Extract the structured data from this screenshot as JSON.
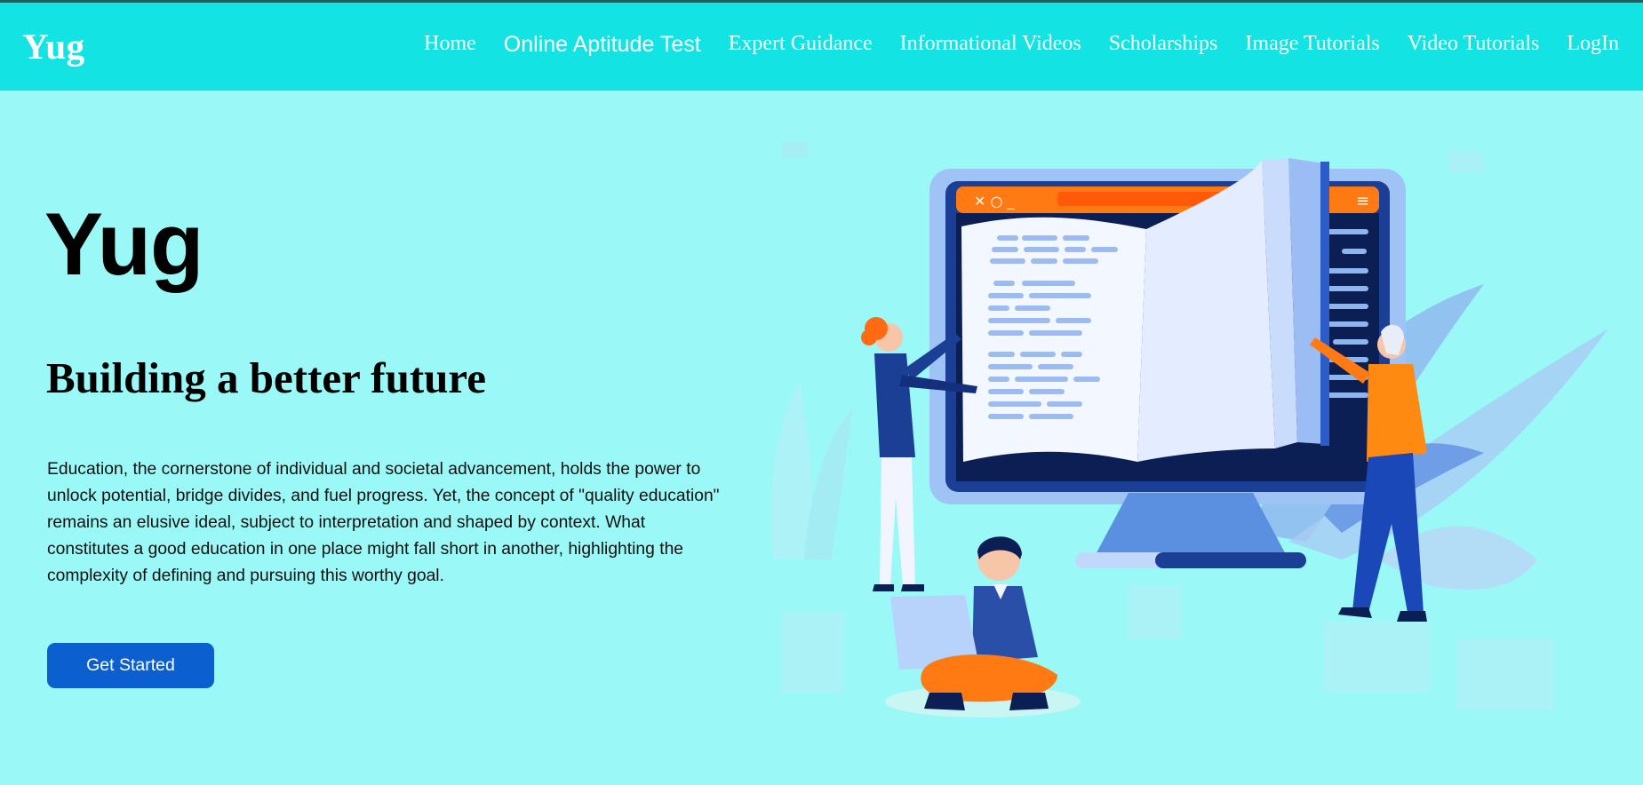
{
  "header": {
    "logo": "Yug",
    "nav": [
      {
        "label": "Home"
      },
      {
        "label": "Online Aptitude Test"
      },
      {
        "label": "Expert Guidance"
      },
      {
        "label": "Informational Videos"
      },
      {
        "label": "Scholarships"
      },
      {
        "label": "Image Tutorials"
      },
      {
        "label": "Video Tutorials"
      },
      {
        "label": "LogIn"
      }
    ]
  },
  "hero": {
    "title": "Yug",
    "subtitle": "Building a better future",
    "body": "Education, the cornerstone of individual and societal advancement, holds the power to unlock potential, bridge divides, and fuel progress. Yet, the concept of \"quality education\" remains an elusive ideal, subject to interpretation and shaped by context. What constitutes a good education in one place might fall short in another, highlighting the complexity of defining and pursuing this worthy goal.",
    "cta_label": "Get Started"
  },
  "colors": {
    "header_bg": "#14e3e3",
    "page_bg": "#9af8f6",
    "cta_bg": "#0b5fcf"
  },
  "illustration": {
    "icon": "education-illustration",
    "window_controls": "✕ ○ _",
    "menu_icon": "≡"
  }
}
